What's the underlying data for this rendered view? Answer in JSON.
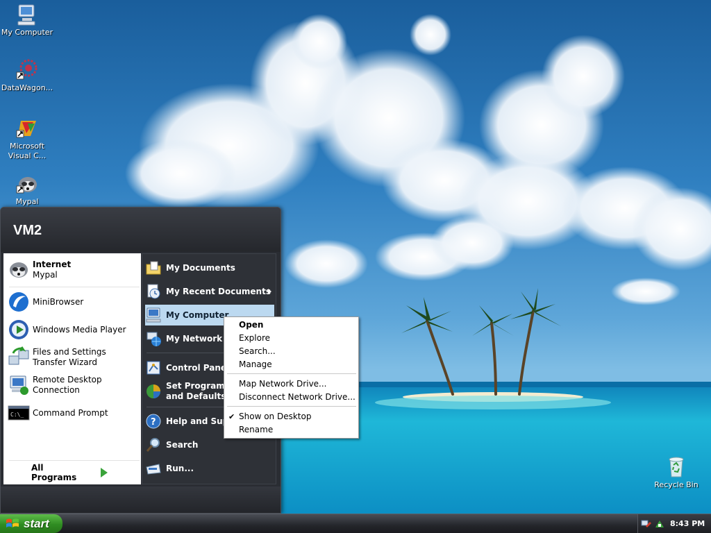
{
  "desktop": {
    "icons": [
      {
        "label": "My Computer",
        "icon": "computer-icon"
      },
      {
        "label": "DataWagon...",
        "icon": "datawagon-icon"
      },
      {
        "label": "Microsoft Visual C...",
        "icon": "visual-c-icon"
      },
      {
        "label": "Mypal",
        "icon": "mypal-icon"
      },
      {
        "label": "Recycle Bin",
        "icon": "recycle-bin-icon"
      }
    ]
  },
  "start_menu": {
    "user_name": "VM2",
    "pinned": [
      {
        "title": "Internet",
        "subtitle": "Mypal",
        "icon": "mypal-icon"
      }
    ],
    "recent": [
      {
        "label": "MiniBrowser",
        "icon": "minibrowser-icon"
      },
      {
        "label": "Windows Media Player",
        "icon": "media-player-icon"
      },
      {
        "label": "Files and Settings Transfer Wizard",
        "icon": "transfer-wizard-icon"
      },
      {
        "label": "Remote Desktop Connection",
        "icon": "remote-desktop-icon"
      },
      {
        "label": "Command Prompt",
        "icon": "command-prompt-icon"
      }
    ],
    "all_programs": "All Programs",
    "places": [
      {
        "label": "My Documents",
        "icon": "my-documents-icon"
      },
      {
        "label": "My Recent Documents",
        "icon": "recent-documents-icon"
      },
      {
        "label": "My Computer",
        "icon": "computer-icon"
      },
      {
        "label": "My Network Places",
        "icon": "network-places-icon"
      },
      {
        "label": "Control Panel",
        "icon": "control-panel-icon"
      },
      {
        "label": "Set Program Access and Defaults",
        "icon": "program-access-icon"
      },
      {
        "label": "Help and Support",
        "icon": "help-icon"
      },
      {
        "label": "Search",
        "icon": "search-icon"
      },
      {
        "label": "Run...",
        "icon": "run-icon"
      }
    ]
  },
  "context_menu": {
    "items": [
      "Open",
      "Explore",
      "Search...",
      "Manage",
      "Map Network Drive...",
      "Disconnect Network Drive...",
      "Show on Desktop",
      "Rename"
    ],
    "checked_mark": "✔"
  },
  "taskbar": {
    "start_label": "start",
    "clock": "8:43 PM"
  },
  "colors": {
    "start_green": "#3a9a2a",
    "menu_dark": "#2a2d33",
    "highlight": "#bcd9f0"
  }
}
